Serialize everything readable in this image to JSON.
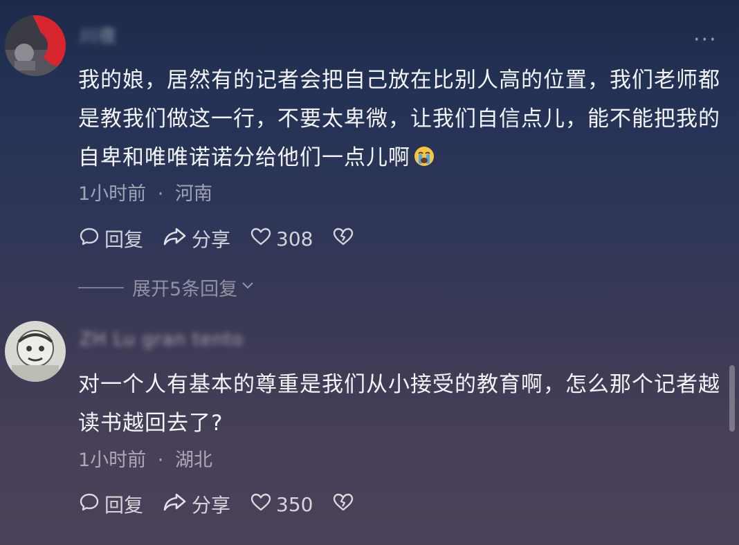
{
  "comments": [
    {
      "username": "川夜",
      "text": "我的娘，居然有的记者会把自己放在比别人高的位置，我们老师都是教我们做这一行，不要太卑微，让我们自信点儿，能不能把我的自卑和唯唯诺诺分给他们一点儿啊",
      "emoji_icon": "loudly-crying-face-icon",
      "time": "1小时前",
      "location": "河南",
      "reply_label": "回复",
      "share_label": "分享",
      "likes": "308",
      "expand_label": "展开5条回复"
    },
    {
      "username": "ZH Lu gran tento",
      "text": "对一个人有基本的尊重是我们从小接受的教育啊，怎么那个记者越读书越回去了?",
      "time": "1小时前",
      "location": "湖北",
      "reply_label": "回复",
      "share_label": "分享",
      "likes": "350"
    }
  ],
  "separator": "·",
  "colors": {
    "accent_text": "#f4f4f6",
    "muted_text": "rgba(255,255,255,0.55)"
  }
}
